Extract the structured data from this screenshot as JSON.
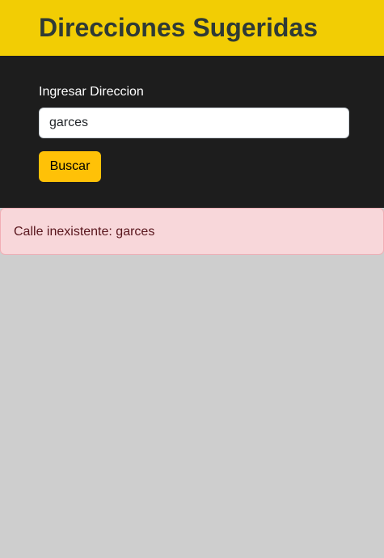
{
  "header": {
    "title": "Direcciones Sugeridas"
  },
  "search": {
    "label": "Ingresar Direccion",
    "value": "garces",
    "button_label": "Buscar"
  },
  "alert": {
    "prefix": "Calle inexistente: ",
    "query": "garces"
  },
  "colors": {
    "header_bg": "#f2cd04",
    "panel_bg": "#1d1d1d",
    "button_bg": "#ffc107",
    "alert_bg": "#f8d7da",
    "page_bg": "#cecece"
  }
}
